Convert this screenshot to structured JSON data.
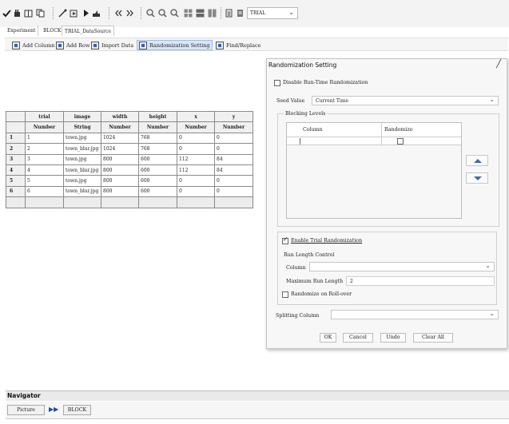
{
  "toolbar": {
    "combo_value": "TRIAL",
    "icons": [
      "check-icon",
      "hand-icon",
      "book-icon",
      "copy-icon",
      "wand-icon",
      "run-icon",
      "play-icon",
      "export-icon",
      "rewind-icon",
      "forward-icon",
      "zoom-in-icon",
      "zoom-out-icon",
      "zoom-fit-icon",
      "grid-icon",
      "grid2-icon",
      "grid3-icon",
      "doc-icon",
      "doc2-icon"
    ]
  },
  "tabs": [
    "Experiment",
    "BLOCK",
    "TRIAL_DataSource"
  ],
  "sheet_toolbar": {
    "add_column": "Add Column",
    "add_row": "Add Row",
    "import_data": "Import Data",
    "randomization_setting": "Randomization Setting",
    "find_replace": "Find/Replace"
  },
  "grid": {
    "headers": [
      {
        "name": "trial",
        "type": "Number"
      },
      {
        "name": "image",
        "type": "String"
      },
      {
        "name": "width",
        "type": "Number"
      },
      {
        "name": "height",
        "type": "Number"
      },
      {
        "name": "x",
        "type": "Number"
      },
      {
        "name": "y",
        "type": "Number"
      }
    ],
    "rows": [
      {
        "num": "1",
        "cells": [
          "1",
          "town.jpg",
          "1024",
          "768",
          "0",
          "0"
        ]
      },
      {
        "num": "2",
        "cells": [
          "2",
          "town_blur.jpg",
          "1024",
          "768",
          "0",
          "0"
        ]
      },
      {
        "num": "3",
        "cells": [
          "3",
          "town.jpg",
          "800",
          "600",
          "112",
          "84"
        ]
      },
      {
        "num": "4",
        "cells": [
          "4",
          "town_blur.jpg",
          "800",
          "600",
          "112",
          "84"
        ]
      },
      {
        "num": "5",
        "cells": [
          "5",
          "town.jpg",
          "800",
          "600",
          "0",
          "0"
        ]
      },
      {
        "num": "6",
        "cells": [
          "6",
          "town_blur.jpg",
          "800",
          "600",
          "0",
          "0"
        ]
      }
    ]
  },
  "dialog": {
    "title": "Randomization Setting",
    "disable_runtime": "Disable Run-Time Randomization",
    "seed_label": "Seed Value",
    "seed_value": "Current Time",
    "blocking_levels": "Blocking Levels",
    "blocking_columns": [
      "Column",
      "Randomize"
    ],
    "enable_trial": "Enable Trial Randomization",
    "run_length_control": "Run Length Control",
    "column_label": "Column",
    "column_value": "",
    "max_run_label": "Maximum Run Length",
    "max_run_value": "2",
    "randomize_rollover": "Randomize on Roll-over",
    "splitting_label": "Splitting Column",
    "splitting_value": "",
    "buttons": {
      "ok": "OK",
      "cancel": "Cancel",
      "undo": "Undo",
      "clear": "Clear All"
    }
  },
  "navigator": {
    "title": "Navigator",
    "crumbs": [
      "Picture",
      "BLOCK"
    ]
  }
}
